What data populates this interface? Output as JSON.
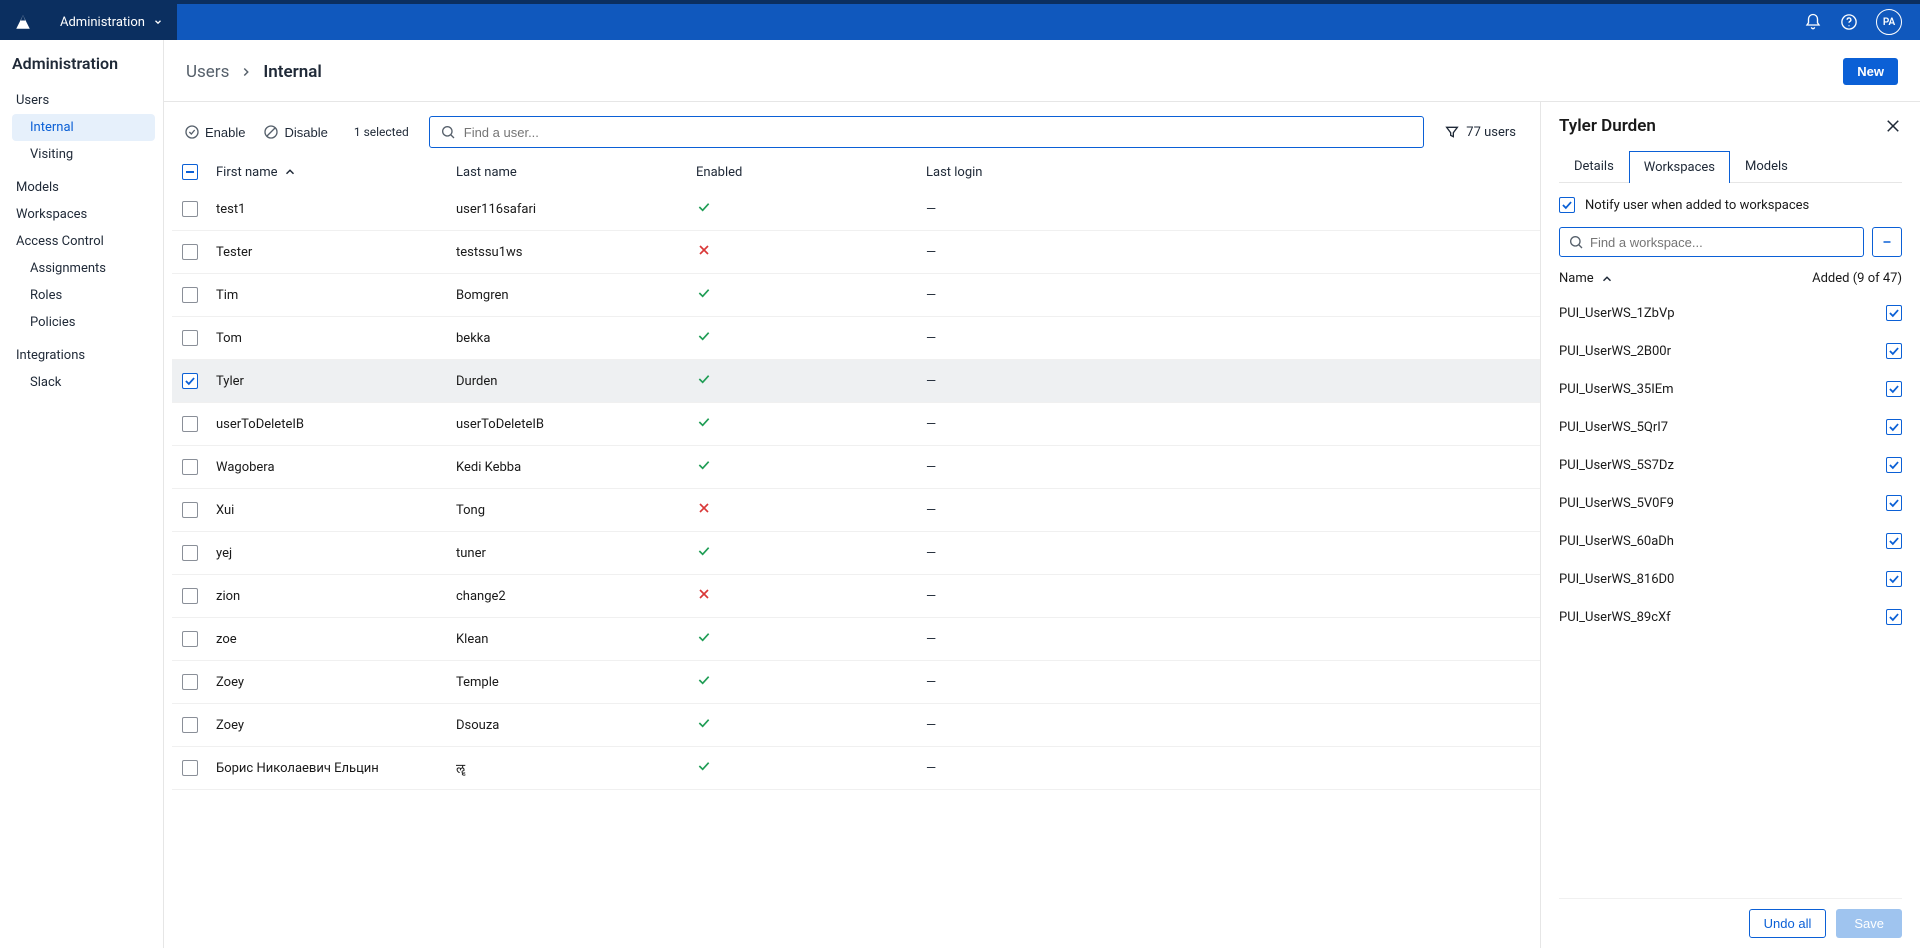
{
  "topbar": {
    "nav_label": "Administration",
    "avatar_initials": "PA"
  },
  "sidebar": {
    "title": "Administration",
    "items": [
      {
        "label": "Users",
        "type": "group"
      },
      {
        "label": "Internal",
        "type": "sub",
        "active": true
      },
      {
        "label": "Visiting",
        "type": "sub"
      },
      {
        "label": "Models",
        "type": "group"
      },
      {
        "label": "Workspaces",
        "type": "group"
      },
      {
        "label": "Access Control",
        "type": "group"
      },
      {
        "label": "Assignments",
        "type": "sub"
      },
      {
        "label": "Roles",
        "type": "sub"
      },
      {
        "label": "Policies",
        "type": "sub"
      },
      {
        "label": "Integrations",
        "type": "group"
      },
      {
        "label": "Slack",
        "type": "sub"
      }
    ]
  },
  "breadcrumb": {
    "seg1": "Users",
    "seg2": "Internal",
    "new_btn": "New"
  },
  "toolbar": {
    "enable": "Enable",
    "disable": "Disable",
    "selected": "1 selected",
    "search_placeholder": "Find a user...",
    "filter_count": "77 users"
  },
  "table": {
    "cols": {
      "c1": "First name",
      "c2": "Last name",
      "c3": "Enabled",
      "c4": "Last login"
    },
    "rows": [
      {
        "first": "test1",
        "last": "user116safari",
        "enabled": true,
        "login": "—",
        "sel": false
      },
      {
        "first": "Tester",
        "last": "testssu1ws",
        "enabled": false,
        "login": "—",
        "sel": false
      },
      {
        "first": "Tim",
        "last": "Bomgren",
        "enabled": true,
        "login": "—",
        "sel": false
      },
      {
        "first": "Tom",
        "last": "bekka",
        "enabled": true,
        "login": "—",
        "sel": false
      },
      {
        "first": "Tyler",
        "last": "Durden",
        "enabled": true,
        "login": "—",
        "sel": true
      },
      {
        "first": "userToDeleteIB",
        "last": "userToDeleteIB",
        "enabled": true,
        "login": "—",
        "sel": false
      },
      {
        "first": "Wagobera",
        "last": "Kedi Kebba",
        "enabled": true,
        "login": "—",
        "sel": false
      },
      {
        "first": "Xui",
        "last": "Tong",
        "enabled": false,
        "login": "—",
        "sel": false
      },
      {
        "first": "yej",
        "last": "tuner",
        "enabled": true,
        "login": "—",
        "sel": false
      },
      {
        "first": "zion",
        "last": "change2",
        "enabled": false,
        "login": "—",
        "sel": false
      },
      {
        "first": "zoe",
        "last": "Klean",
        "enabled": true,
        "login": "—",
        "sel": false
      },
      {
        "first": "Zoey",
        "last": "Temple",
        "enabled": true,
        "login": "—",
        "sel": false
      },
      {
        "first": "Zoey",
        "last": "Dsouza",
        "enabled": true,
        "login": "—",
        "sel": false
      },
      {
        "first": "Борис Николаевич Ельцин",
        "last": "ॡ",
        "enabled": true,
        "login": "—",
        "sel": false
      }
    ]
  },
  "panel": {
    "title": "Tyler Durden",
    "tabs": {
      "t1": "Details",
      "t2": "Workspaces",
      "t3": "Models",
      "active": "t2"
    },
    "notify_label": "Notify user when added to workspaces",
    "ws_search_placeholder": "Find a workspace...",
    "ws_head_name": "Name",
    "ws_head_added": "Added (9 of 47)",
    "undo": "Undo all",
    "save": "Save",
    "workspaces": [
      {
        "name": "PUI_UserWS_1ZbVp"
      },
      {
        "name": "PUI_UserWS_2B00r"
      },
      {
        "name": "PUI_UserWS_35IEm"
      },
      {
        "name": "PUI_UserWS_5QrI7"
      },
      {
        "name": "PUI_UserWS_5S7Dz"
      },
      {
        "name": "PUI_UserWS_5V0F9"
      },
      {
        "name": "PUI_UserWS_60aDh"
      },
      {
        "name": "PUI_UserWS_816D0"
      },
      {
        "name": "PUI_UserWS_89cXf"
      }
    ]
  }
}
